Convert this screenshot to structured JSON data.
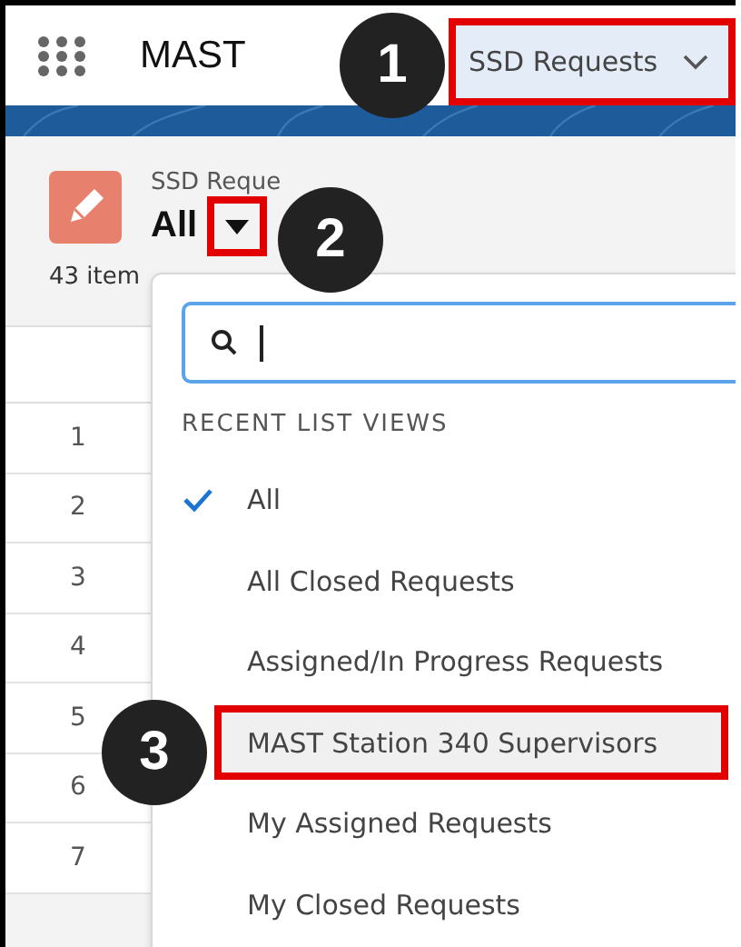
{
  "app": {
    "name": "MAST"
  },
  "nav_tab": {
    "label": "SSD Requests",
    "selected": true,
    "highlighted": true
  },
  "list_header": {
    "object": "SSD Reque",
    "view": "All",
    "view_button_highlighted": true,
    "count": "43 item"
  },
  "table": {
    "row_numbers": [
      "1",
      "2",
      "3",
      "4",
      "5",
      "6",
      "7"
    ]
  },
  "list_views_menu": {
    "section": "RECENT LIST VIEWS",
    "items": [
      {
        "label": "All",
        "checked": true,
        "selected": false,
        "highlighted": false
      },
      {
        "label": "All Closed Requests",
        "checked": false,
        "selected": false,
        "highlighted": false
      },
      {
        "label": "Assigned/In Progress Requests",
        "checked": false,
        "selected": false,
        "highlighted": false
      },
      {
        "label": "MAST Station 340 Supervisors",
        "checked": false,
        "selected": true,
        "highlighted": true
      },
      {
        "label": "My Assigned Requests",
        "checked": false,
        "selected": false,
        "highlighted": false
      },
      {
        "label": "My Closed Requests",
        "checked": false,
        "selected": false,
        "highlighted": false
      }
    ]
  },
  "callouts": [
    {
      "number": "1"
    },
    {
      "number": "2"
    },
    {
      "number": "3"
    }
  ]
}
